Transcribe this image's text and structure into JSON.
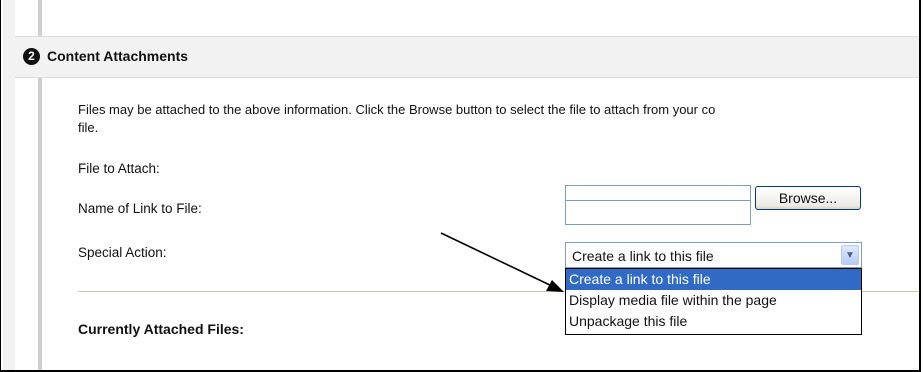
{
  "section": {
    "step_number": "2",
    "title": "Content Attachments"
  },
  "intro": {
    "line1": "Files may be attached to the above information. Click the Browse button to select the file to attach from your co",
    "line2": "file."
  },
  "form": {
    "file_to_attach": {
      "label": "File to Attach:",
      "value": "",
      "browse_label": "Browse..."
    },
    "link_name": {
      "label": "Name of Link to File:",
      "value": ""
    },
    "special_action": {
      "label": "Special Action:",
      "selected": "Create a link to this file",
      "options": [
        "Create a link to this file",
        "Display media file within the page",
        "Unpackage this file"
      ],
      "dropdown_open": true,
      "highlighted_index": 0
    }
  },
  "attached_files": {
    "heading": "Currently Attached Files:"
  },
  "icons": {
    "select_arrow": "chevron-down-icon",
    "annotation": "arrow-pointer-icon"
  },
  "colors": {
    "highlight": "#316ac5",
    "header_bg": "#f2f2f2",
    "input_border": "#7f9db9"
  }
}
